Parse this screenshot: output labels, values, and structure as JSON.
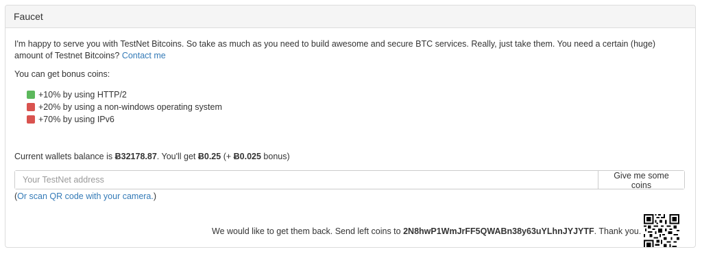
{
  "panel": {
    "title": "Faucet"
  },
  "intro": {
    "text": "I'm happy to serve you with TestNet Bitcoins. So take as much as you need to build awesome and secure BTC services. Really, just take them. You need a certain (huge) amount of Testnet Bitcoins?",
    "contact_link": "Contact me"
  },
  "bonus": {
    "label": "You can get bonus coins:",
    "items": [
      {
        "text": "+10% by using HTTP/2",
        "color": "#5cb85c"
      },
      {
        "text": "+20% by using a non-windows operating system",
        "color": "#d9534f"
      },
      {
        "text": "+70% by using IPv6",
        "color": "#d9534f"
      }
    ]
  },
  "balance": {
    "prefix": "Current wallets balance is ",
    "wallet": "Ƀ32178.87",
    "middle": ". You'll get ",
    "amount": "Ƀ0.25",
    "bonus_open": " (+ ",
    "bonus": "Ƀ0.025",
    "bonus_close": " bonus)"
  },
  "form": {
    "placeholder": "Your TestNet address",
    "button_label": "Give me some coins"
  },
  "scan": {
    "open": "(",
    "link": "Or scan QR code with your camera.",
    "close": ")"
  },
  "return": {
    "prefix": "We would like to get them back. Send left coins to ",
    "address": "2N8hwP1WmJrFF5QWABn38y63uYLhnJYJYTF",
    "suffix": ". Thank you."
  },
  "colors": {
    "link": "#337ab7",
    "success": "#5cb85c",
    "danger": "#d9534f"
  }
}
